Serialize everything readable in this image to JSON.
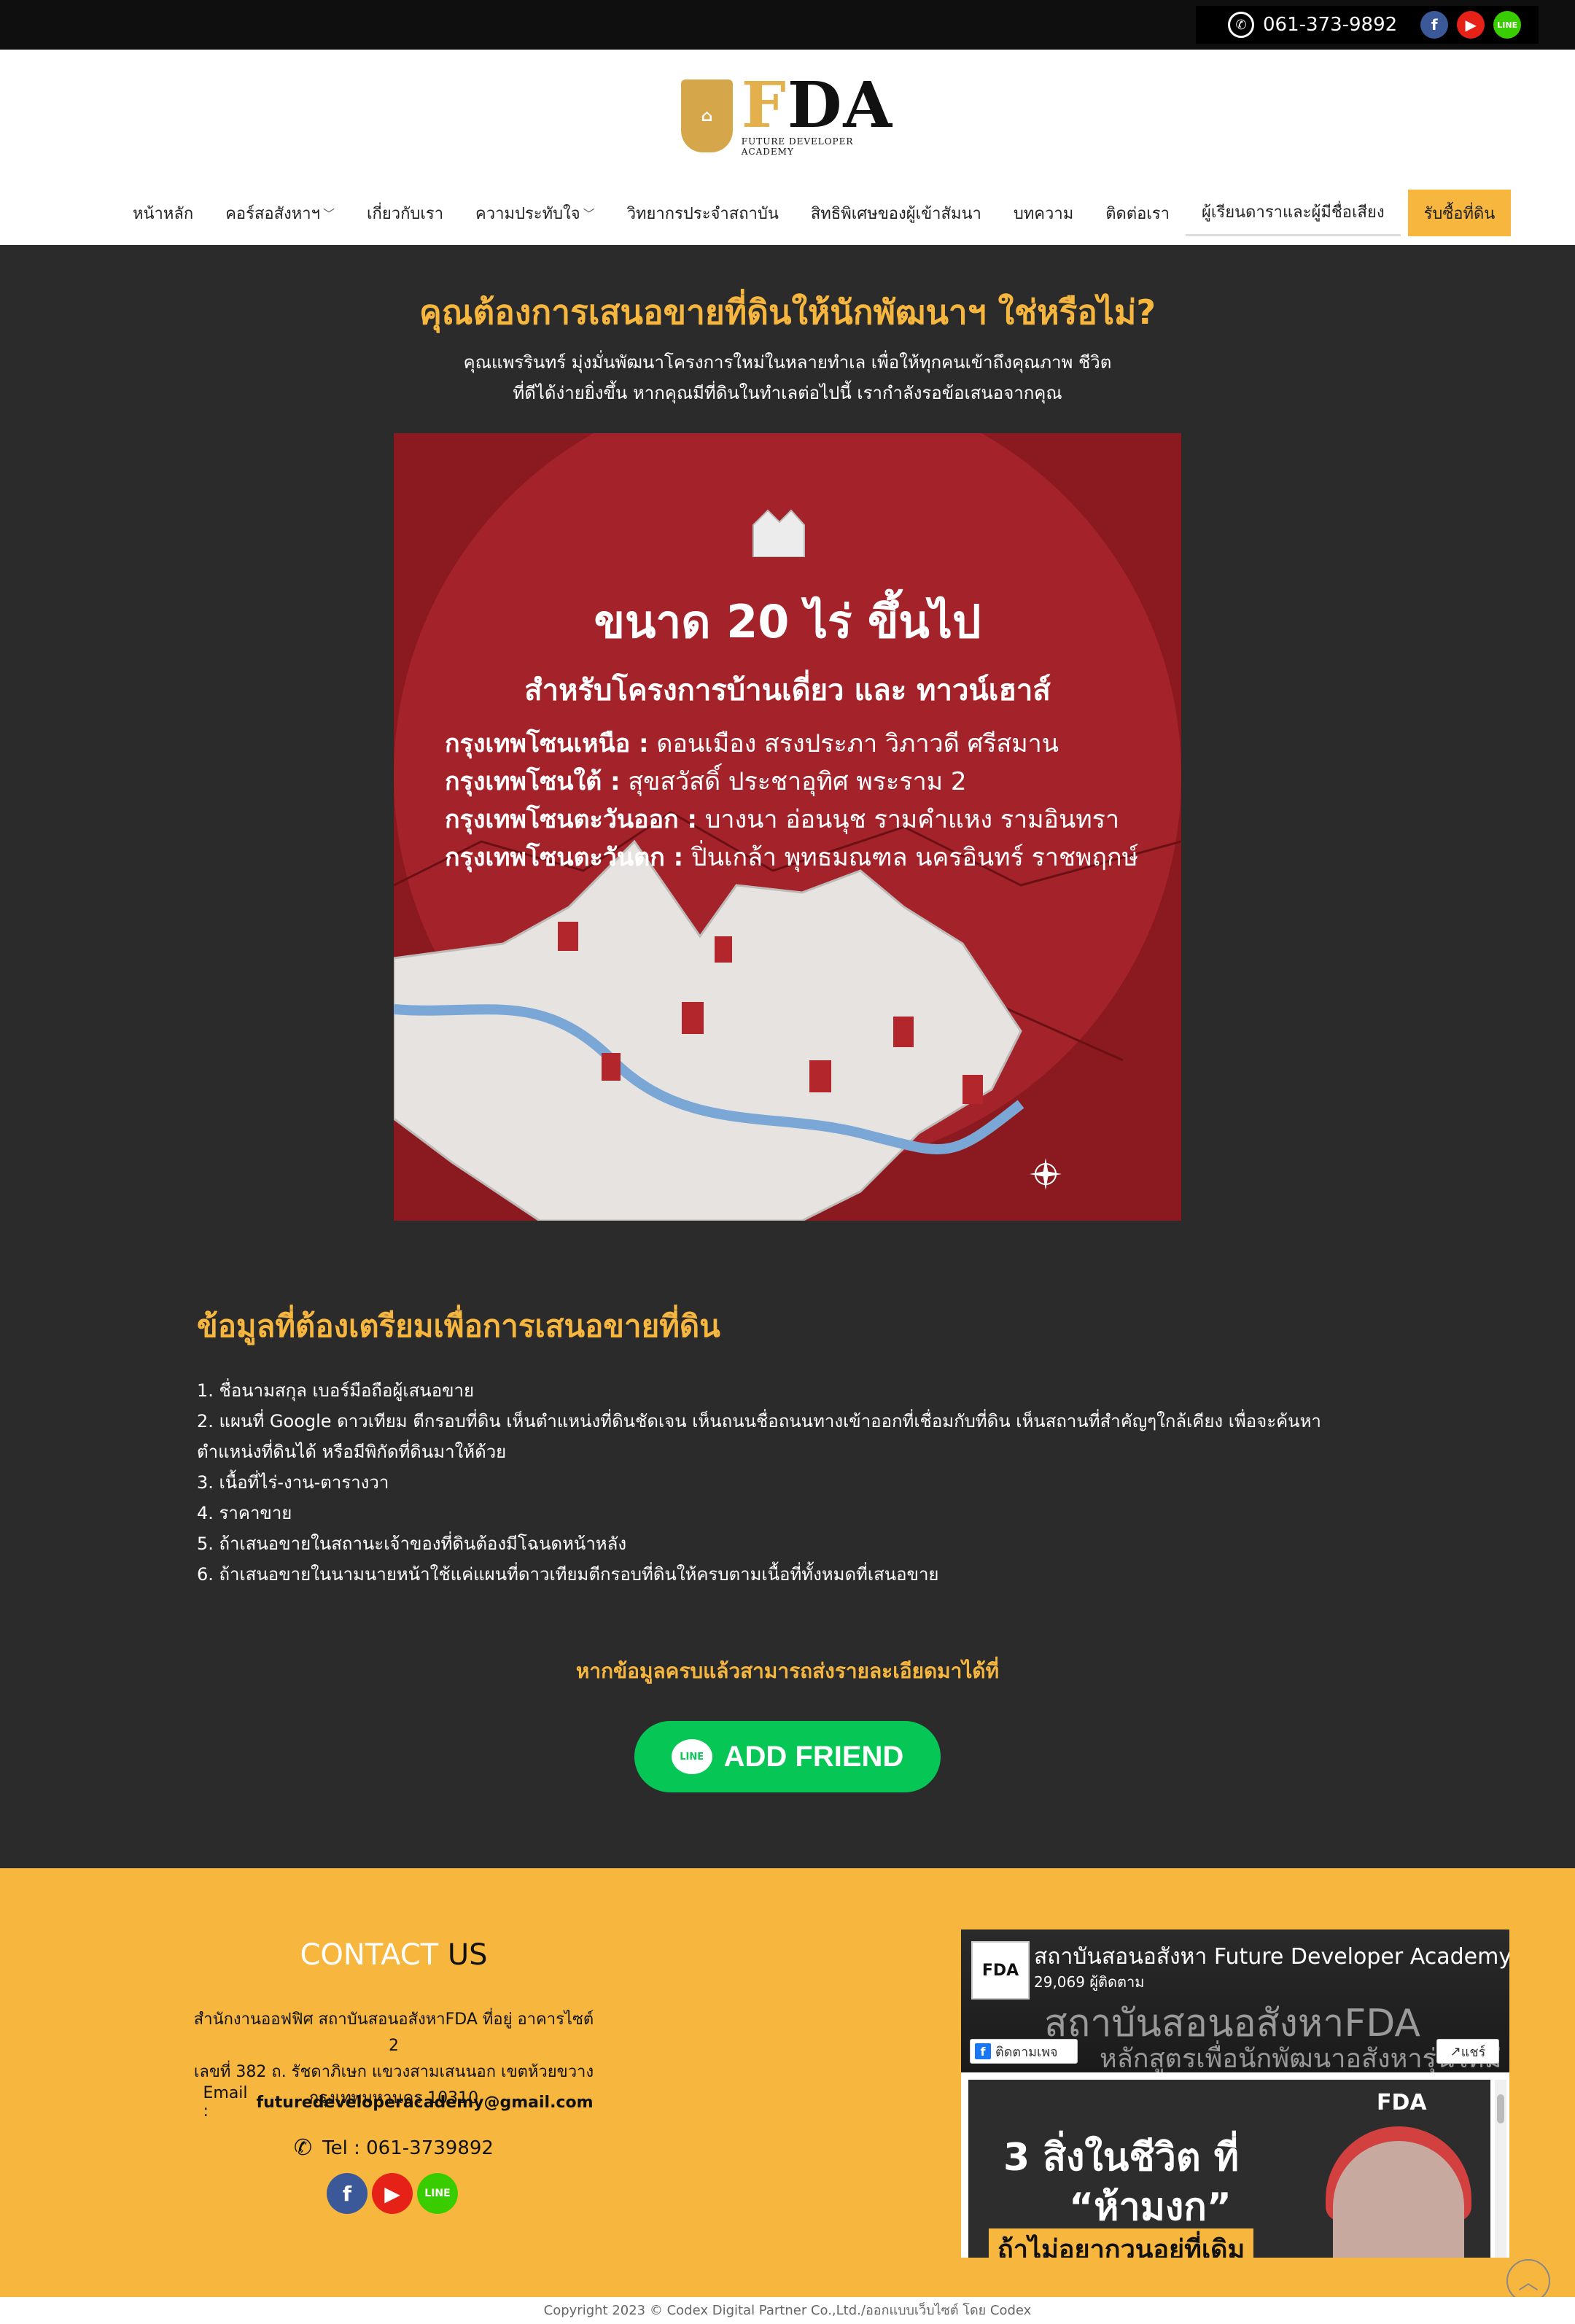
{
  "topbar": {
    "phone": "061-373-9892",
    "whatsapp_icon": "whatsapp-icon",
    "social": [
      "facebook-icon",
      "youtube-icon",
      "line-icon"
    ]
  },
  "logo": {
    "letters_f": "F",
    "letters_rest": "DA",
    "subtitle": "FUTURE DEVELOPER ACADEMY"
  },
  "nav": {
    "items": [
      {
        "label": "หน้าหลัก"
      },
      {
        "label": "คอร์สอสังหาฯ"
      },
      {
        "label": "เกี่ยวกับเรา"
      },
      {
        "label": "ความประทับใจ"
      },
      {
        "label": "วิทยากรประจำสถาบัน"
      },
      {
        "label": "สิทธิพิเศษของผู้เข้าสัมนา"
      },
      {
        "label": "บทความ"
      },
      {
        "label": "ติดต่อเรา"
      },
      {
        "label": "ผู้เรียนดาราและผู้มีชื่อเสียง"
      },
      {
        "label": "รับซื้อที่ดิน"
      }
    ]
  },
  "main": {
    "headline": "คุณต้องการเสนอขายที่ดินให้นักพัฒนาฯ ใช่หรือไม่?",
    "intro_line1": "คุณแพรรินทร์ มุ่งมั่นพัฒนาโครงการใหม่ในหลายทำเล เพื่อให้ทุกคนเข้าถึงคุณภาพ ชีวิต",
    "intro_line2": "ที่ดีได้ง่ายยิ่งขึ้น หากคุณมีที่ดินในทำเลต่อไปนี้ เรากำลังรอข้อเสนอจากคุณ",
    "banner": {
      "title": "ขนาด 20 ไร่ ขึ้นไป",
      "subtitle": "สำหรับโครงการบ้านเดี่ยว และ ทาวน์เฮาส์",
      "zones": [
        {
          "zone": "กรุงเทพโซนเหนือ :",
          "areas": " ดอนเมือง สรงประภา วิภาวดี ศรีสมาน"
        },
        {
          "zone": "กรุงเทพโซนใต้ :",
          "areas": " สุขสวัสดิ์ ประชาอุทิศ พระราม 2"
        },
        {
          "zone": "กรุงเทพโซนตะวันออก :",
          "areas": " บางนา อ่อนนุช รามคำแหง รามอินทรา"
        },
        {
          "zone": "กรุงเทพโซนตะวันตก :",
          "areas": " ปิ่นเกล้า พุทธมณฑล นครอินทร์ ราชพฤกษ์"
        }
      ]
    },
    "section_title": "ข้อมูลที่ต้องเตรียมเพื่อการเสนอขายที่ดิน",
    "steps": [
      "1. ชื่อนามสกุล เบอร์มือถือผู้เสนอขาย",
      "2. แผนที่ Google ดาวเทียม ตีกรอบที่ดิน เห็นตำแหน่งที่ดินชัดเจน เห็นถนนชื่อถนนทางเข้าออกที่เชื่อมกับที่ดิน เห็นสถานที่สำคัญๆใกล้เคียง เพื่อจะค้นหาตำแหน่งที่ดินได้ หรือมีพิกัดที่ดินมาให้ด้วย",
      "3. เนื้อที่ไร่-งาน-ตารางวา",
      "4. ราคาขาย",
      "5. ถ้าเสนอขายในสถานะเจ้าของที่ดินต้องมีโฉนดหน้าหลัง",
      "6. ถ้าเสนอขายในนามนายหน้าใช้แค่แผนที่ดาวเทียมตีกรอบที่ดินให้ครบตามเนื้อที่ทั้งหมดที่เสนอขาย"
    ],
    "cta_text": "หากข้อมูลครบแล้วสามารถส่งรายละเอียดมาได้ที่",
    "add_friend": "ADD FRIEND",
    "line_badge": "LINE"
  },
  "footer": {
    "contact_word1": "CONTACT",
    "contact_word2": "US",
    "address_line1": "สำนักงานออฟฟิศ สถาบันสอนอสังหาFDA ที่อยู่ อาคารไซต์ 2",
    "address_line2": "เลขที่ 382 ถ. รัชดาภิเษก แขวงสามเสนนอก เขตห้วยขวาง",
    "address_line3": "กรุงเทพมหานคร 10310",
    "email_label": "Email : ",
    "email": "futuredeveloperacademy@gmail.com",
    "tel": "Tel : 061-3739892",
    "fb_widget": {
      "page_name": "สถาบันสอนอสังหา Future Developer Academy",
      "followers": "29,069 ผู้ติดตาม",
      "cover_text1": "สถาบันสอนอสังหาFDA",
      "cover_text2": "หลักสูตรเพื่อนักพัฒนาอสังหารุ่นใหม่",
      "follow_label": "ติดตามเพจ",
      "share_label": "แชร์",
      "post_logo": "FDA",
      "post_line1": "3 สิ่งในชีวิต ที่",
      "post_line2": "“ห้ามงก”",
      "post_line3": "ถ้าไม่อยากวนอยู่ที่เดิม"
    }
  },
  "copyright": "Copyright 2023 © Codex Digital Partner Co.,Ltd./ออกแบบเว็บไซต์ โดย Codex",
  "colors": {
    "accent": "#f7b73f",
    "dark": "#2b2b2b",
    "line_green": "#06c755"
  }
}
